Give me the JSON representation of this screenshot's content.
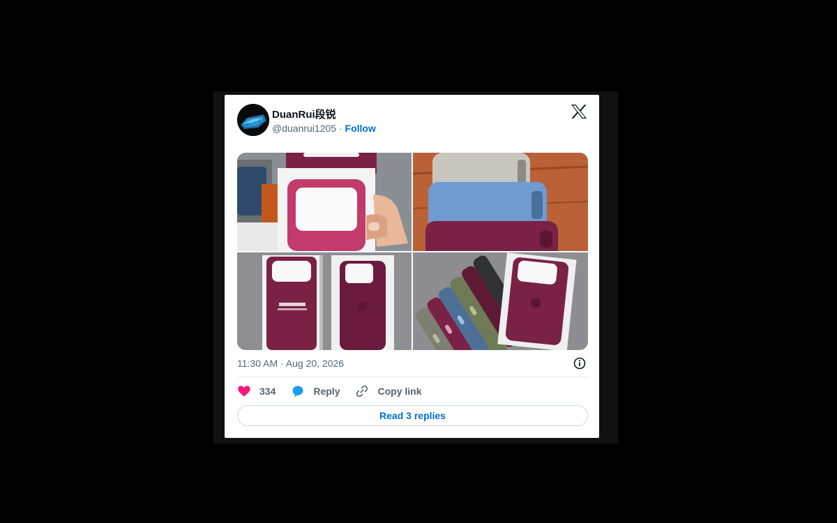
{
  "tweet": {
    "author_name": "DuanRui段锐",
    "handle": "@duanrui1205",
    "separator": " · ",
    "follow_label": "Follow",
    "timestamp": "11:30 AM · Aug 20, 2026",
    "like_count": "334",
    "reply_label": "Reply",
    "copy_link_label": "Copy link",
    "read_replies_label": "Read 3 replies"
  },
  "media": [
    {
      "name": "photo-burgundy-case-in-packaging"
    },
    {
      "name": "photo-stacked-cases-grey-blue-burgundy"
    },
    {
      "name": "photo-iphone-16-pro-max-techwoven-case-box"
    },
    {
      "name": "photo-multicolor-cases-fanned"
    }
  ],
  "colors": {
    "like_heart": "#f91880",
    "reply_bubble": "#1d9bf0",
    "link_blue": "#006fd6",
    "muted_text": "#536471"
  },
  "icons": [
    "x-logo-icon",
    "info-icon",
    "heart-icon",
    "reply-icon",
    "link-icon"
  ]
}
